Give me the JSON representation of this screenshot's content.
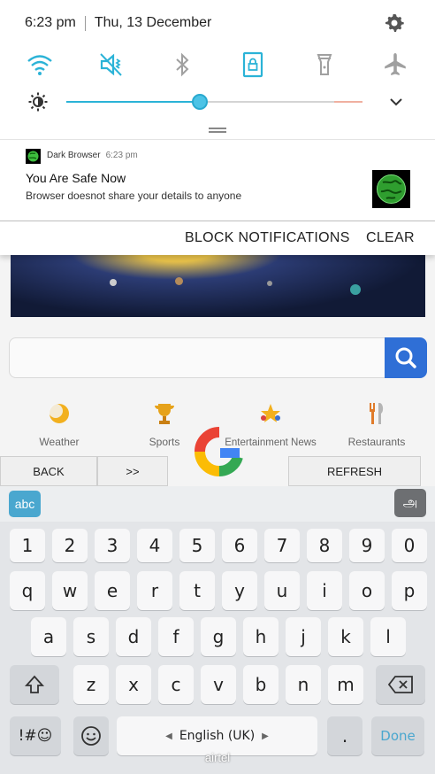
{
  "status_bar": {
    "time": "6:23 pm",
    "date": "Thu, 13 December"
  },
  "quick_settings": {
    "icons": [
      "wifi-icon",
      "mute-icon",
      "bluetooth-icon",
      "rotation-lock-icon",
      "flashlight-icon",
      "airplane-icon"
    ],
    "accent_color": "#2bb3d7",
    "brightness_level": 0.45
  },
  "notification": {
    "app_name": "Dark Browser",
    "time": "6:23 pm",
    "title": "You Are Safe Now",
    "body": "Browser doesnot share your details to anyone",
    "actions": {
      "block": "BLOCK NOTIFICATIONS",
      "clear": "CLEAR"
    }
  },
  "browser": {
    "shortcuts": [
      {
        "label": "Weather",
        "icon": "weather-icon"
      },
      {
        "label": "Sports",
        "icon": "trophy-icon"
      },
      {
        "label": "Entertainment News",
        "icon": "stars-icon"
      },
      {
        "label": "Restaurants",
        "icon": "cutlery-icon"
      }
    ],
    "nav": {
      "back": "BACK",
      "forward": ">>",
      "refresh": "REFRESH"
    }
  },
  "keyboard": {
    "mode_label": "abc",
    "language_key": "அ",
    "numbers": [
      "1",
      "2",
      "3",
      "4",
      "5",
      "6",
      "7",
      "8",
      "9",
      "0"
    ],
    "row1": [
      "q",
      "w",
      "e",
      "r",
      "t",
      "y",
      "u",
      "i",
      "o",
      "p"
    ],
    "row2": [
      "a",
      "s",
      "d",
      "f",
      "g",
      "h",
      "j",
      "k",
      "l"
    ],
    "row3": [
      "z",
      "x",
      "c",
      "v",
      "b",
      "n",
      "m"
    ],
    "symbols_label": "!#☺",
    "space_label": "English (UK)",
    "period": ".",
    "done_label": "Done"
  },
  "carrier": "airtel"
}
